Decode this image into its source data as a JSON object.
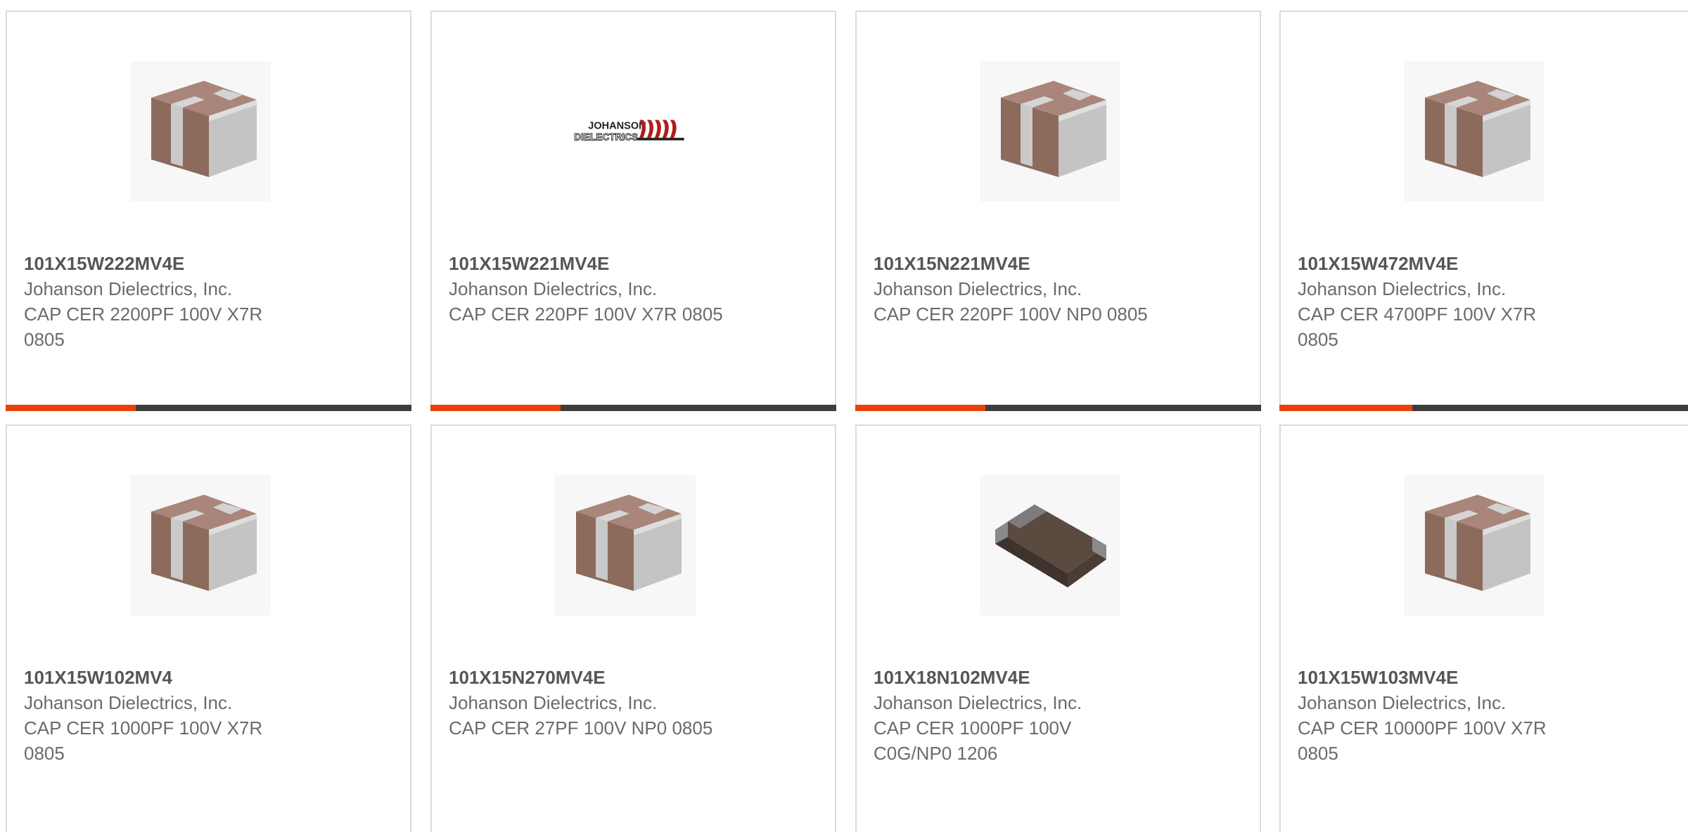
{
  "colors": {
    "accent": "#e8410a",
    "progress_track": "#3d3d3d",
    "card_border": "#dcdcdc",
    "title_text": "#555555",
    "body_text": "#6b6b6b"
  },
  "cards": [
    {
      "part_number": "101X15W222MV4E",
      "manufacturer": "Johanson Dielectrics, Inc.",
      "description_line1": "CAP CER 2200PF 100V X7R",
      "description_line2": "0805",
      "image": "mlcc-capacitor-icon",
      "progress": 0.32
    },
    {
      "part_number": "101X15W221MV4E",
      "manufacturer": "Johanson Dielectrics, Inc.",
      "description_line1": "CAP CER 220PF 100V X7R 0805",
      "description_line2": "",
      "image": "johanson-dielectrics-logo",
      "logo_line1": "JOHANSON",
      "logo_line2": "DIELECTRICS",
      "progress": 0.32
    },
    {
      "part_number": "101X15N221MV4E",
      "manufacturer": "Johanson Dielectrics, Inc.",
      "description_line1": "CAP CER 220PF 100V NP0 0805",
      "description_line2": "",
      "image": "mlcc-capacitor-icon",
      "progress": 0.32
    },
    {
      "part_number": "101X15W472MV4E",
      "manufacturer": "Johanson Dielectrics, Inc.",
      "description_line1": "CAP CER 4700PF 100V X7R",
      "description_line2": "0805",
      "image": "mlcc-capacitor-icon",
      "progress": 0.32
    },
    {
      "part_number": "101X15W102MV4",
      "manufacturer": "Johanson Dielectrics, Inc.",
      "description_line1": "CAP CER 1000PF 100V X7R",
      "description_line2": "0805",
      "image": "mlcc-capacitor-icon"
    },
    {
      "part_number": "101X15N270MV4E",
      "manufacturer": "Johanson Dielectrics, Inc.",
      "description_line1": "CAP CER 27PF 100V NP0 0805",
      "description_line2": "",
      "image": "mlcc-capacitor-icon"
    },
    {
      "part_number": "101X18N102MV4E",
      "manufacturer": "Johanson Dielectrics, Inc.",
      "description_line1": "CAP CER 1000PF 100V",
      "description_line2": "C0G/NP0 1206",
      "image": "dark-capacitor-icon"
    },
    {
      "part_number": "101X15W103MV4E",
      "manufacturer": "Johanson Dielectrics, Inc.",
      "description_line1": "CAP CER 10000PF 100V X7R",
      "description_line2": "0805",
      "image": "mlcc-capacitor-icon"
    }
  ]
}
